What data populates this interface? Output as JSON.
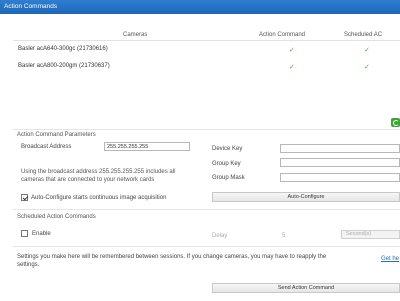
{
  "window": {
    "title": "Action Commands"
  },
  "cameras": {
    "columns": [
      "Cameras",
      "Action Command",
      "Scheduled AC"
    ],
    "rows": [
      {
        "name": "Basler acA640-300gc (21730616)",
        "action_command": "✓",
        "scheduled_ac": "✓"
      },
      {
        "name": "Basler acA800-200gm (21730637)",
        "action_command": "✓",
        "scheduled_ac": "✓"
      }
    ]
  },
  "params": {
    "section_title": "Action Command Parameters",
    "broadcast_label": "Broadcast Address",
    "broadcast_value": "255.255.255.255",
    "device_key_label": "Device Key",
    "group_key_label": "Group Key",
    "group_mask_label": "Group Mask",
    "info_text": "Using the broadcast address 255.255.255.255 includes all cameras that are connected to your network cards",
    "auto_configure_checkbox_label": "Auto-Configure starts continuous image acquisition",
    "auto_configure_button": "Auto-Configure"
  },
  "scheduled": {
    "section_title": "Scheduled Action Commands",
    "enable_label": "Enable",
    "delay_label": "Delay",
    "delay_value": "5",
    "delay_unit": "Second(s)"
  },
  "footer": {
    "note": "Settings you make here will be remembered between sessions. If you change cameras, you may have to reapply the settings.",
    "help_link": "Get he",
    "send_button": "Send Action Command"
  }
}
